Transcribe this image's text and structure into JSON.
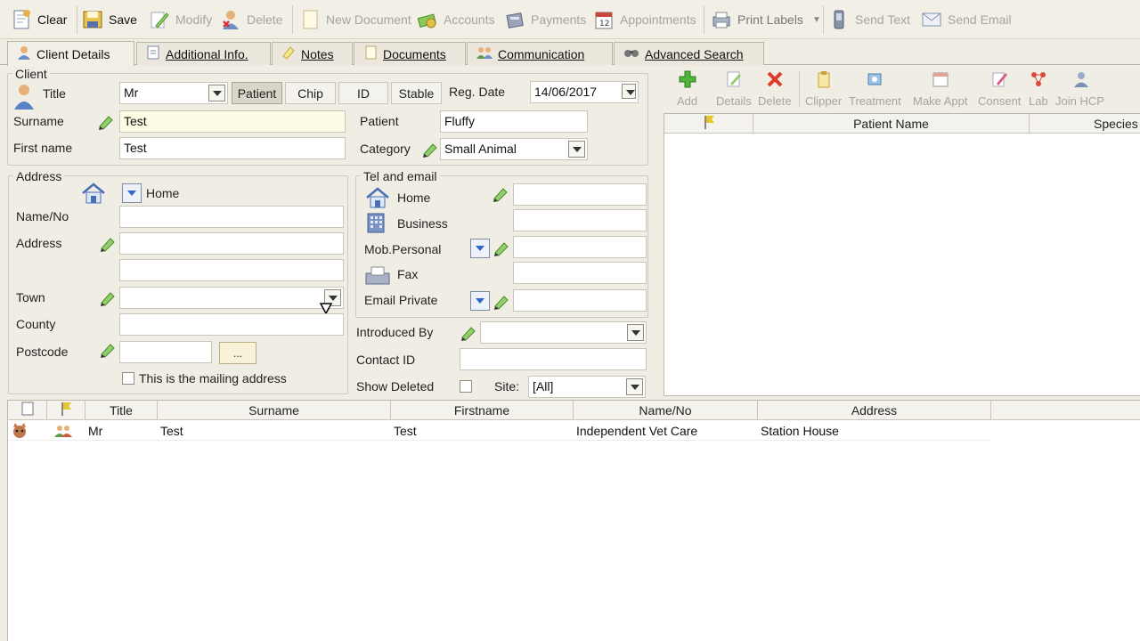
{
  "toolbar": {
    "clear": "Clear",
    "save": "Save",
    "modify": "Modify",
    "delete": "Delete",
    "new_document": "New Document",
    "accounts": "Accounts",
    "payments": "Payments",
    "appointments": "Appointments",
    "print_labels": "Print Labels",
    "send_text": "Send Text",
    "send_email": "Send Email"
  },
  "tabs": [
    "Client Details",
    "Additional Info.",
    "Notes",
    "Documents",
    "Communication",
    "Advanced Search"
  ],
  "client": {
    "group_label": "Client",
    "title_label": "Title",
    "title_value": "Mr",
    "mode_buttons": [
      "Patient",
      "Chip",
      "ID",
      "Stable"
    ],
    "reg_date_label": "Reg. Date",
    "reg_date_value": "14/06/2017",
    "surname_label": "Surname",
    "surname_value": "Test",
    "firstname_label": "First name",
    "firstname_value": "Test",
    "patient_label": "Patient",
    "patient_value": "Fluffy",
    "category_label": "Category",
    "category_value": "Small Animal"
  },
  "address": {
    "group_label": "Address",
    "type_value": "Home",
    "nameno_label": "Name/No",
    "address_label": "Address",
    "town_label": "Town",
    "county_label": "County",
    "postcode_label": "Postcode",
    "lookup_label": "...",
    "mailing_label": "This is the mailing address"
  },
  "tel": {
    "group_label": "Tel and email",
    "home_label": "Home",
    "business_label": "Business",
    "mobile_label": "Mob.Personal",
    "fax_label": "Fax",
    "email_label": "Email Private"
  },
  "misc": {
    "introduced_label": "Introduced By",
    "contact_label": "Contact ID",
    "show_deleted_label": "Show Deleted",
    "site_label": "Site:",
    "site_value": "[All]"
  },
  "patient_toolbar": [
    "Add",
    "Details",
    "Delete",
    "Clipper",
    "Treatment",
    "Make Appt",
    "Consent",
    "Lab",
    "Join HCP"
  ],
  "patient_grid": {
    "columns": [
      "Patient Name",
      "Species"
    ]
  },
  "results_grid": {
    "columns": [
      "Title",
      "Surname",
      "Firstname",
      "Name/No",
      "Address"
    ],
    "rows": [
      {
        "title": "Mr",
        "surname": "Test",
        "firstname": "Test",
        "nameno": "Independent Vet Care",
        "address": "Station House"
      }
    ]
  }
}
